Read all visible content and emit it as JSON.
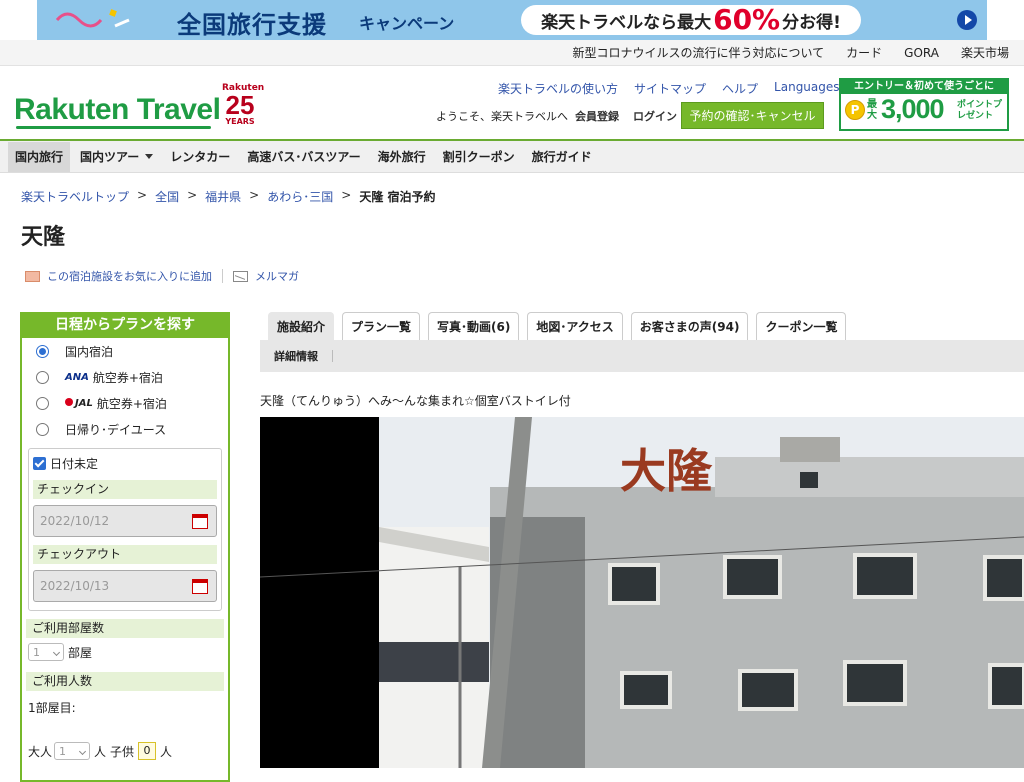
{
  "banner": {
    "campaign_main": "全国旅行支援",
    "campaign_sub": "キャンペーン",
    "pill_pre": "楽天トラベルなら最大",
    "pill_big": "60%",
    "pill_post": "分お得!"
  },
  "util_links": [
    "新型コロナウイルスの流行に伴う対応について",
    "カード",
    "GORA",
    "楽天市場"
  ],
  "header": {
    "logo": "Rakuten Travel",
    "anniv_brand": "Rakuten",
    "anniv_num": "25",
    "anniv_years": "YEARS",
    "links": [
      "楽天トラベルの使い方",
      "サイトマップ",
      "ヘルプ"
    ],
    "languages": "Languages",
    "welcome": "ようこそ、楽天トラベルへ",
    "member": "会員登録",
    "login": "ログイン",
    "reserve": "予約の確認･キャンセル",
    "promo_top": "エントリー＆初めて使うごとに",
    "promo_coin": "P",
    "promo_lbl": "最大",
    "promo_amt": "3,000",
    "promo_pt": "ポイントプレゼント"
  },
  "nav": [
    "国内旅行",
    "国内ツアー",
    "レンタカー",
    "高速バス･バスツアー",
    "海外旅行",
    "割引クーポン",
    "旅行ガイド"
  ],
  "breadcrumb": [
    "楽天トラベルトップ",
    "全国",
    "福井県",
    "あわら･三国"
  ],
  "breadcrumb_current": "天隆 宿泊予約",
  "title": "天隆",
  "actions": {
    "fav": "この宿泊施設をお気に入りに追加",
    "mail": "メルマガ"
  },
  "sidebar": {
    "head": "日程からプランを探す",
    "opt1": "国内宿泊",
    "ana": "ANA",
    "opt2": "航空券+宿泊",
    "jal": "JAL",
    "opt3": "航空券+宿泊",
    "opt4": "日帰り･デイユース",
    "undecided": "日付未定",
    "checkin_label": "チェックイン",
    "checkin": "2022/10/12",
    "checkout_label": "チェックアウト",
    "checkout": "2022/10/13",
    "rooms_label": "ご利用部屋数",
    "rooms": "1",
    "rooms_unit": "部屋",
    "guests_label": "ご利用人数",
    "room1": "1部屋目:",
    "adult": "大人",
    "adult_num": "1",
    "person": "人",
    "child": "子供",
    "child_num": "0",
    "person2": "人"
  },
  "tabs": [
    "施設紹介",
    "プラン一覧",
    "写真･動画(6)",
    "地図･アクセス",
    "お客さまの声(94)",
    "クーポン一覧"
  ],
  "subtab": "詳細情報",
  "catch": "天隆（てんりゅう）へみ～んな集まれ☆個室バストイレ付"
}
